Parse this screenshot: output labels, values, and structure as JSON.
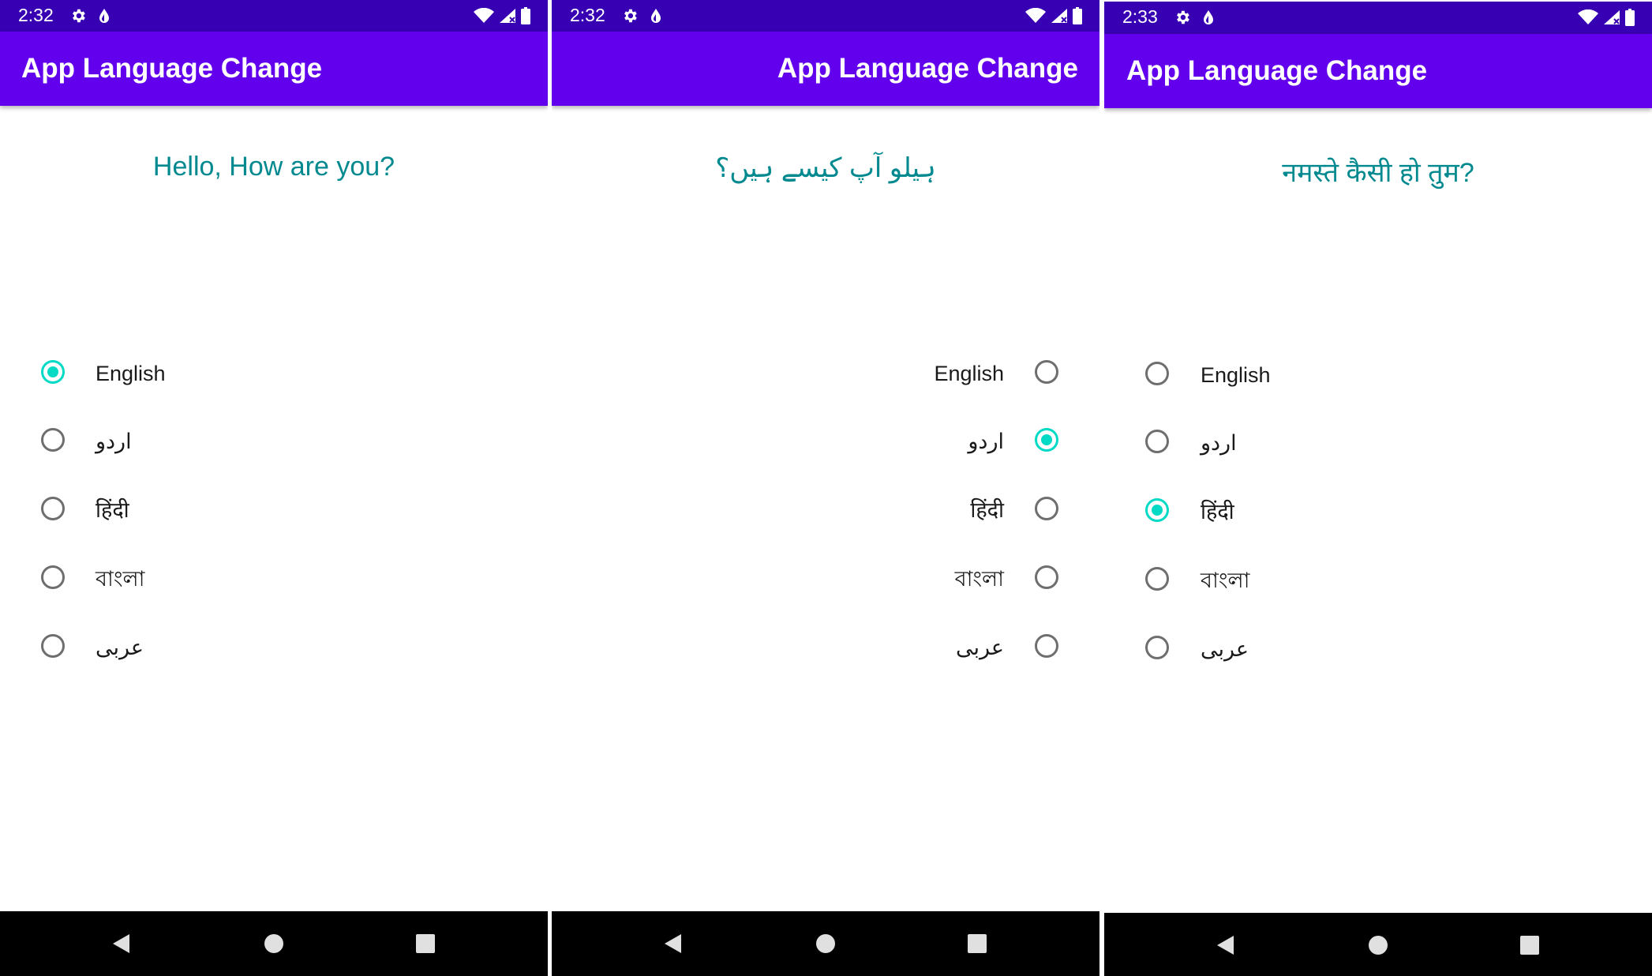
{
  "phones": [
    {
      "status": {
        "time": "2:32"
      },
      "app_title": "App Language Change",
      "greeting": "Hello, How are you?",
      "options": [
        {
          "label": "English",
          "selected": true
        },
        {
          "label": "اردو",
          "selected": false
        },
        {
          "label": "हिंदी",
          "selected": false
        },
        {
          "label": "বাংলা",
          "selected": false
        },
        {
          "label": "عربى",
          "selected": false
        }
      ]
    },
    {
      "status": {
        "time": "2:32"
      },
      "app_title": "App Language Change",
      "greeting": "ہیلو آپ کیسے ہیں؟",
      "options": [
        {
          "label": "English",
          "selected": false
        },
        {
          "label": "اردو",
          "selected": true
        },
        {
          "label": "हिंदी",
          "selected": false
        },
        {
          "label": "বাংলা",
          "selected": false
        },
        {
          "label": "عربى",
          "selected": false
        }
      ]
    },
    {
      "status": {
        "time": "2:33"
      },
      "app_title": "App Language Change",
      "greeting": "नमस्ते कैसी हो तुम?",
      "options": [
        {
          "label": "English",
          "selected": false
        },
        {
          "label": "اردو",
          "selected": false
        },
        {
          "label": "हिंदी",
          "selected": true
        },
        {
          "label": "বাংলা",
          "selected": false
        },
        {
          "label": "عربى",
          "selected": false
        }
      ]
    }
  ],
  "colors": {
    "status_bar": "#3700b3",
    "app_bar": "#6200ee",
    "accent": "#03dac5",
    "greeting_text": "#00898f",
    "nav_bar": "#000000"
  },
  "icons": {
    "status_left": [
      "settings-gear-icon",
      "data-saver-icon"
    ],
    "status_right": [
      "wifi-icon",
      "cell-signal-icon",
      "battery-icon"
    ],
    "nav": [
      "back-triangle-icon",
      "home-circle-icon",
      "recents-square-icon"
    ]
  }
}
